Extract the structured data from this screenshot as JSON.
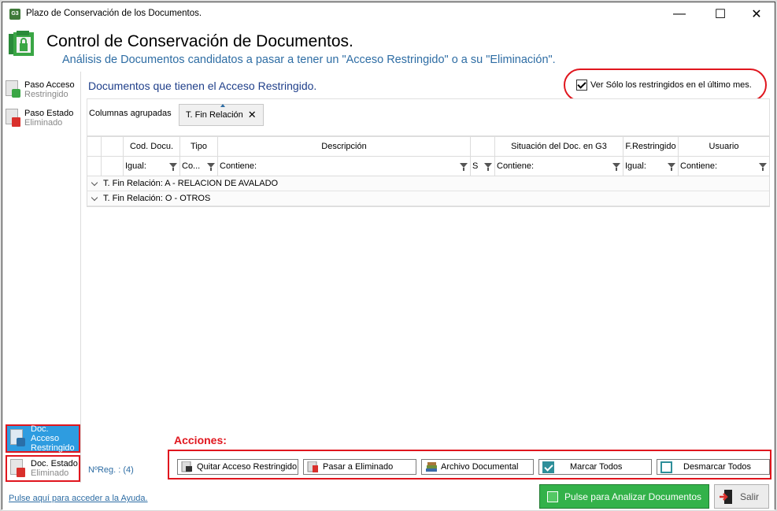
{
  "window": {
    "title": "Plazo de Conservación de los Documentos.",
    "app_icon_text": "G3",
    "minimize": "—",
    "maximize": "☐",
    "close": "✕"
  },
  "header": {
    "title": "Control de Conservación de Documentos.",
    "subtitle": "Análisis de Documentos candidatos a pasar a tener un \"Acceso Restringido\" o a su \"Eliminación\"."
  },
  "sidebar": {
    "items": [
      {
        "line1": "Paso Acceso",
        "line2": "Restringido"
      },
      {
        "line1": "Paso Estado",
        "line2": "Eliminado"
      },
      {
        "line1": "Doc. Acceso",
        "line2": "Restringido"
      },
      {
        "line1": "Doc. Estado",
        "line2": "Eliminado"
      }
    ]
  },
  "panel": {
    "title": "Documentos que tienen el Acceso Restringido.",
    "checkbox_label": "Ver Sólo los restringidos en el último mes.",
    "checkbox_checked": true
  },
  "grouping": {
    "label": "Columnas agrupadas",
    "chip": "T. Fin Relación",
    "chip_close": "✕"
  },
  "grid": {
    "headers": [
      "",
      "",
      "Cod. Docu.",
      "Tipo",
      "Descripción",
      "",
      "Situación del Doc. en G3",
      "F.Restringido",
      "Usuario"
    ],
    "filters": [
      "",
      "",
      "Igual:",
      "Co...",
      "Contiene:",
      "S",
      "Contiene:",
      "Igual:",
      "Contiene:"
    ],
    "groups": [
      "T. Fin Relación: A - RELACION DE AVALADO",
      "T. Fin Relación: O - OTROS"
    ]
  },
  "actions": {
    "label": "Acciones:",
    "reg_count": "NºReg. : (4)",
    "buttons": [
      "Quitar Acceso Restringido",
      "Pasar a Eliminado",
      "Archivo Documental",
      "Marcar Todos",
      "Desmarcar Todos"
    ]
  },
  "footer": {
    "help_link": "Pulse aquí para acceder a la Ayuda.",
    "analyze": "Pulse para Analizar Documentos",
    "exit": "Salir"
  },
  "colors": {
    "accent_blue": "#2e6da4",
    "highlight_red": "#e0161e",
    "selected_blue": "#2e9ce0",
    "green_button": "#33b24a"
  }
}
